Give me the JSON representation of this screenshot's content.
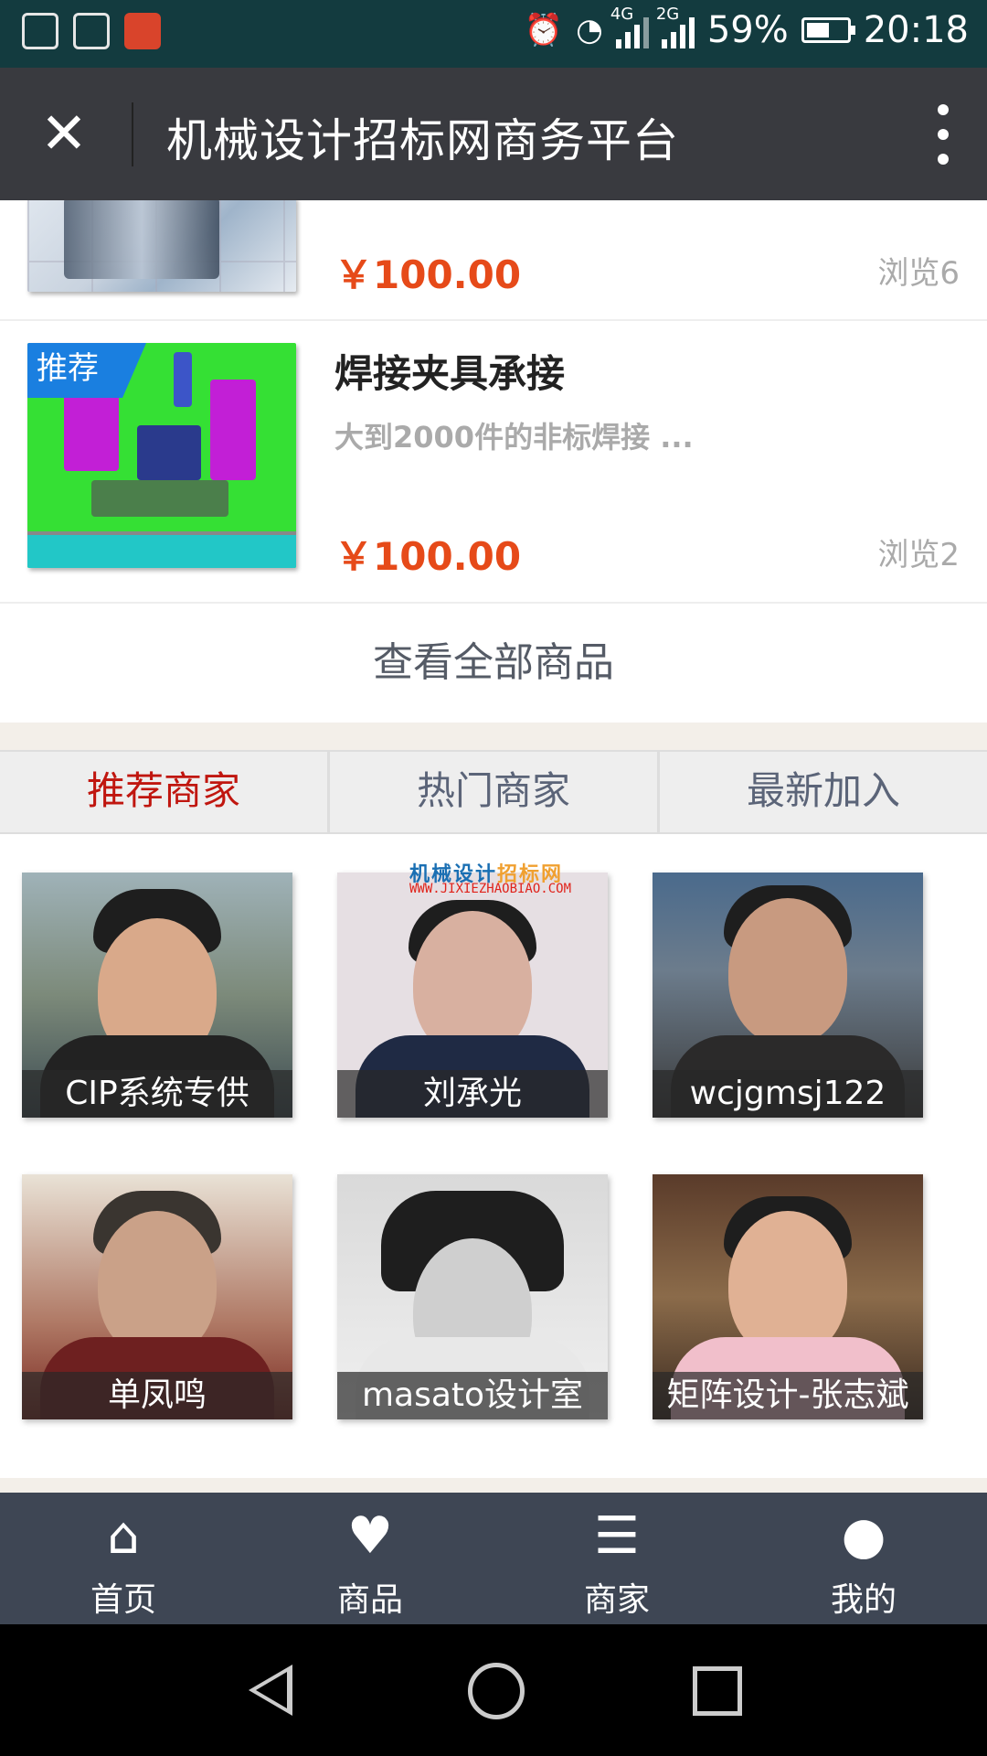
{
  "status_bar": {
    "battery": "59%",
    "time": "20:18",
    "net1": "4G",
    "net2": "2G",
    "battery_level": 0.59
  },
  "header": {
    "title": "机械设计招标网商务平台",
    "close_icon": "close-icon",
    "more_icon": "more-vertical-icon"
  },
  "products": [
    {
      "price": "￥100.00",
      "views": "浏览6"
    },
    {
      "badge": "推荐",
      "name": "焊接夹具承接",
      "desc": "大到2000件的非标焊接 ...",
      "price": "￥100.00",
      "views": "浏览2"
    }
  ],
  "view_all": "查看全部商品",
  "merchant_tabs": [
    {
      "label": "推荐商家",
      "active": true
    },
    {
      "label": "热门商家",
      "active": false
    },
    {
      "label": "最新加入",
      "active": false
    }
  ],
  "merchants": [
    {
      "name": "CIP系统专供"
    },
    {
      "name": "刘承光"
    },
    {
      "name": "wcjgmsj122"
    },
    {
      "name": "单凤鸣"
    },
    {
      "name": "masato设计室"
    },
    {
      "name": "矩阵设计-张志斌"
    }
  ],
  "watermark": {
    "line1_a": "机械设计",
    "line1_b": "招标网",
    "line2": "WWW.JIXIEZHAOBIAO.COM"
  },
  "tabbar": [
    {
      "label": "首页",
      "icon": "home-icon"
    },
    {
      "label": "商品",
      "icon": "heart-icon"
    },
    {
      "label": "商家",
      "icon": "list-icon"
    },
    {
      "label": "我的",
      "icon": "user-icon"
    }
  ],
  "colors": {
    "price": "#e64a19",
    "active_tab": "#c0160f",
    "header_bg": "#393a3f",
    "tabbar_bg": "#3e4654",
    "badge_bg": "#1a7fe0"
  }
}
